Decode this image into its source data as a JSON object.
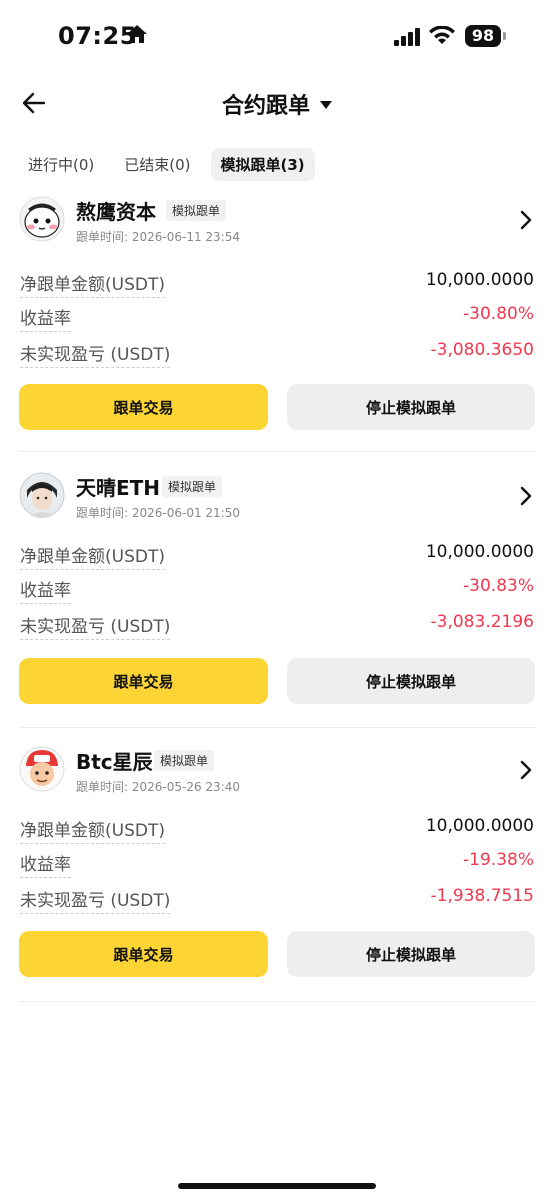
{
  "status_bar": {
    "time": "07:25",
    "battery": "98"
  },
  "header": {
    "title": "合约跟单"
  },
  "tabs": [
    {
      "label": "进行中(0)",
      "active": false
    },
    {
      "label": "已结束(0)",
      "active": false
    },
    {
      "label": "模拟跟单(3)",
      "active": true
    }
  ],
  "labels": {
    "net_amount": "净跟单金额(USDT)",
    "yield": "收益率",
    "unrealized": "未实现盈亏 (USDT)",
    "trade_button": "跟单交易",
    "stop_button": "停止模拟跟单"
  },
  "colors": {
    "accent": "#fcd535",
    "negative": "#f0384f"
  },
  "cards": [
    {
      "name": "熬鹰资本",
      "badge": "模拟跟单",
      "time": "跟单时间: 2026-06-11 23:54",
      "net_amount": "10,000.0000",
      "yield": "-30.80%",
      "unrealized": "-3,080.3650"
    },
    {
      "name": "天晴ETH",
      "badge": "模拟跟单",
      "time": "跟单时间: 2026-06-01 21:50",
      "net_amount": "10,000.0000",
      "yield": "-30.83%",
      "unrealized": "-3,083.2196"
    },
    {
      "name": "Btc星辰",
      "badge": "模拟跟单",
      "time": "跟单时间: 2026-05-26 23:40",
      "net_amount": "10,000.0000",
      "yield": "-19.38%",
      "unrealized": "-1,938.7515"
    }
  ]
}
